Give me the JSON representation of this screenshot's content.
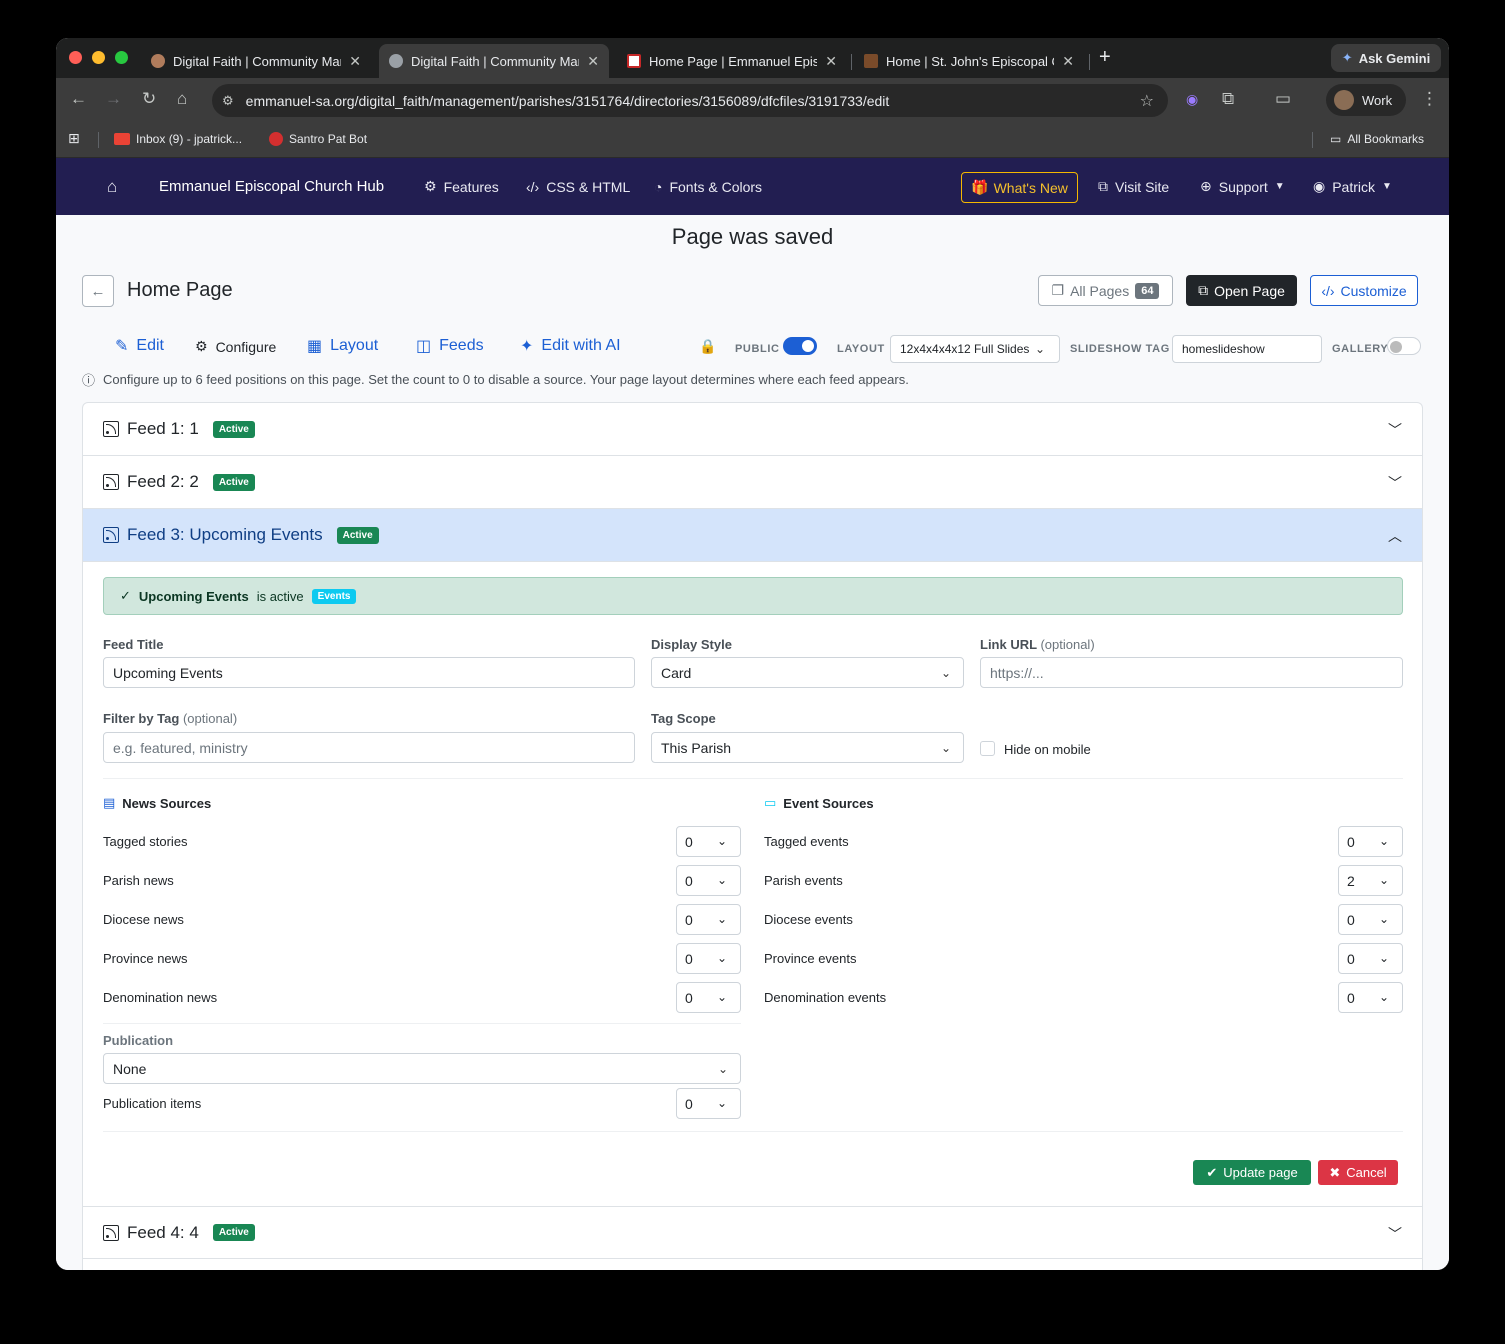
{
  "browser": {
    "tabs": [
      {
        "title": "Digital Faith | Community Man",
        "active": false
      },
      {
        "title": "Digital Faith | Community Man",
        "active": true
      },
      {
        "title": "Home Page | Emmanuel Episc",
        "active": false
      },
      {
        "title": "Home | St. John's Episcopal C",
        "active": false
      }
    ],
    "gemini_label": "Ask Gemini",
    "url": "emmanuel-sa.org/digital_faith/management/parishes/3151764/directories/3156089/dfcfiles/3191733/edit",
    "profile_label": "Work",
    "bookmarks": [
      {
        "label": "Inbox (9) - jpatrick..."
      },
      {
        "label": "Santro Pat Bot"
      }
    ],
    "all_bookmarks_label": "All Bookmarks"
  },
  "appnav": {
    "brand": "Emmanuel Episcopal Church Hub",
    "items": [
      "Features",
      "CSS & HTML",
      "Fonts & Colors"
    ],
    "whats_new": "What's New",
    "visit_site": "Visit Site",
    "support": "Support",
    "user": "Patrick"
  },
  "flash": "Page was saved",
  "page": {
    "title": "Home Page",
    "all_pages_label": "All Pages",
    "all_pages_count": "64",
    "open_page_label": "Open Page",
    "customize_label": "Customize"
  },
  "subtabs": [
    "Edit",
    "Configure",
    "Layout",
    "Feeds",
    "Edit with AI"
  ],
  "controls": {
    "public_label": "PUBLIC",
    "public_on": true,
    "layout_label": "LAYOUT",
    "layout_value": "12x4x4x4x12 Full Slides",
    "slideshow_label": "SLIDESHOW TAG",
    "slideshow_value": "homeslideshow",
    "gallery_label": "GALLERY",
    "gallery_on": false
  },
  "info": "Configure up to 6 feed positions on this page. Set the count to 0 to disable a source. Your page layout determines where each feed appears.",
  "feeds": [
    {
      "title": "Feed 1: 1",
      "badge": "Active"
    },
    {
      "title": "Feed 2: 2",
      "badge": "Active"
    },
    {
      "title": "Feed 3: Upcoming Events",
      "badge": "Active"
    },
    {
      "title": "Feed 4: 4",
      "badge": "Active"
    }
  ],
  "feed3": {
    "alert_name": "Upcoming Events",
    "alert_text": "is active",
    "alert_badge": "Events",
    "feed_title_label": "Feed Title",
    "feed_title_value": "Upcoming Events",
    "display_style_label": "Display Style",
    "display_style_value": "Card",
    "link_url_label": "Link URL",
    "link_url_optional": "(optional)",
    "link_url_placeholder": "https://...",
    "filter_tag_label": "Filter by Tag",
    "filter_tag_optional": "(optional)",
    "filter_tag_placeholder": "e.g. featured, ministry",
    "tag_scope_label": "Tag Scope",
    "tag_scope_value": "This Parish",
    "hide_mobile_label": "Hide on mobile",
    "news_heading": "News Sources",
    "news": [
      {
        "label": "Tagged stories",
        "value": "0"
      },
      {
        "label": "Parish news",
        "value": "0"
      },
      {
        "label": "Diocese news",
        "value": "0"
      },
      {
        "label": "Province news",
        "value": "0"
      },
      {
        "label": "Denomination news",
        "value": "0"
      }
    ],
    "events_heading": "Event Sources",
    "events": [
      {
        "label": "Tagged events",
        "value": "0"
      },
      {
        "label": "Parish events",
        "value": "2"
      },
      {
        "label": "Diocese events",
        "value": "0"
      },
      {
        "label": "Province events",
        "value": "0"
      },
      {
        "label": "Denomination events",
        "value": "0"
      }
    ],
    "publication_label": "Publication",
    "publication_value": "None",
    "publication_items_label": "Publication items",
    "publication_items_value": "0",
    "update_label": "Update page",
    "cancel_label": "Cancel"
  },
  "colors": {
    "navbar": "#221e51",
    "primary": "#1c5fd4",
    "success": "#198754",
    "danger": "#dc3545",
    "accent": "#f5b800"
  }
}
